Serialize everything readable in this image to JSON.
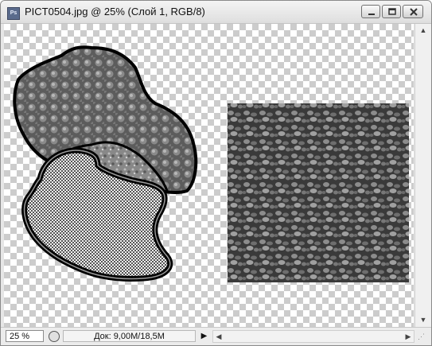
{
  "window": {
    "title": "PICT0504.jpg @ 25% (Слой 1, RGB/8)",
    "app_icon_text": "Ps",
    "buttons": {
      "minimize": "minimize-icon",
      "maximize": "maximize-icon",
      "close": "close-icon"
    }
  },
  "status_bar": {
    "zoom": "25 %",
    "doc_info": "Док: 9,00M/18,5M",
    "menu_arrow": "▶"
  },
  "scrollbars": {
    "up_arrow": "▲",
    "down_arrow": "▼",
    "left_arrow": "◀",
    "right_arrow": "▶"
  },
  "colors": {
    "outline": "#000000",
    "texture_dark": "#555555",
    "texture_light": "#9a9a9a",
    "transparency_checker": "#cccccc"
  }
}
